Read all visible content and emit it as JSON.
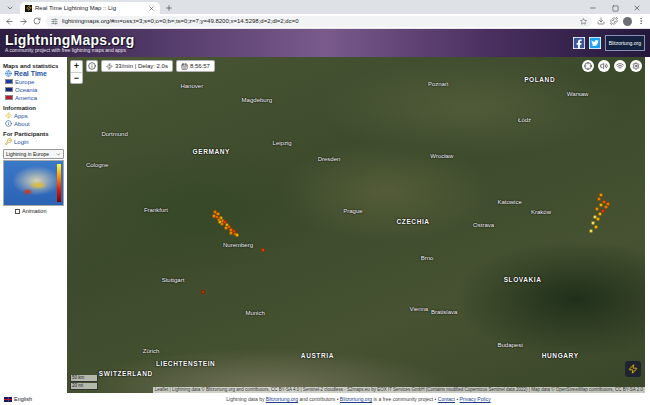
{
  "browser": {
    "tab": {
      "title": "Real Time Lightning Map :: Lig",
      "selected": true
    },
    "url": "lightningmaps.org/#m=oss;t=3;s=0;o=0;b=;ts=0;z=7;y=49.8200;x=14.5298;d=2;dl=2;dc=0"
  },
  "header": {
    "logo": "LightningMaps.org",
    "tagline": "A community project with free lightning maps and apps",
    "partner": "Blitzortung.org"
  },
  "sidebar": {
    "sections": [
      {
        "title": "Maps and statistics",
        "items": [
          {
            "label": "Real Time",
            "kind": "globe",
            "selected": true
          },
          {
            "label": "Europe",
            "kind": "flag",
            "color": "#1f3fa0",
            "selected": false
          },
          {
            "label": "Oceania",
            "kind": "flag",
            "color": "#14287a",
            "selected": false
          },
          {
            "label": "America",
            "kind": "flag",
            "color": "#b22234",
            "selected": false
          }
        ]
      },
      {
        "title": "Information",
        "items": [
          {
            "label": "Apps",
            "kind": "bolt",
            "selected": false
          },
          {
            "label": "About",
            "kind": "info",
            "selected": false
          }
        ]
      },
      {
        "title": "For Participants",
        "items": [
          {
            "label": "Login",
            "kind": "key",
            "selected": false
          }
        ]
      }
    ],
    "select": "Lightning in Europe",
    "animation": {
      "label": "Animation",
      "checked": false
    }
  },
  "map": {
    "center": {
      "lat": 49.82,
      "lon": 14.5298
    },
    "controls": {
      "zoom_in": "+",
      "zoom_out": "−",
      "rate": "33/min | Delay: 2.0s",
      "time": "8:56:57"
    },
    "scale": [
      "50 km",
      "20 mi"
    ],
    "attribution": "Leaflet | Lightning data © Blitzortung.org and contributors, CC BY-SA 4.0 | Sentinel-2 cloudless - S2maps.eu by EOX IT Services GmbH (Contains modified Copernicus Sentinel data 2022) | Map data © OpenStreetMap contributors, CC BY-SA 2.0",
    "places": [
      {
        "name": "Hanover",
        "kind": "city",
        "lat": 52.37,
        "lon": 9.73
      },
      {
        "name": "Magdeburg",
        "kind": "city",
        "lat": 52.13,
        "lon": 11.63
      },
      {
        "name": "Dortmund",
        "kind": "city",
        "lat": 51.51,
        "lon": 7.47
      },
      {
        "name": "Cologne",
        "kind": "city",
        "lat": 50.94,
        "lon": 6.96
      },
      {
        "name": "Leipzig",
        "kind": "city",
        "lat": 51.34,
        "lon": 12.37
      },
      {
        "name": "Dresden",
        "kind": "city",
        "lat": 51.05,
        "lon": 13.74
      },
      {
        "name": "Frankfurt",
        "kind": "city",
        "lat": 50.11,
        "lon": 8.68
      },
      {
        "name": "Nuremberg",
        "kind": "city",
        "lat": 49.45,
        "lon": 11.08
      },
      {
        "name": "Stuttgart",
        "kind": "city",
        "lat": 48.78,
        "lon": 9.18
      },
      {
        "name": "Munich",
        "kind": "city",
        "lat": 48.14,
        "lon": 11.58
      },
      {
        "name": "Zürich",
        "kind": "city",
        "lat": 47.38,
        "lon": 8.54
      },
      {
        "name": "Prague",
        "kind": "city",
        "lat": 50.08,
        "lon": 14.44
      },
      {
        "name": "Brno",
        "kind": "city",
        "lat": 49.2,
        "lon": 16.61
      },
      {
        "name": "Wrocław",
        "kind": "city",
        "lat": 51.11,
        "lon": 17.04
      },
      {
        "name": "Poznań",
        "kind": "city",
        "lat": 52.41,
        "lon": 16.93
      },
      {
        "name": "Łódź",
        "kind": "city",
        "lat": 51.76,
        "lon": 19.46
      },
      {
        "name": "Warsaw",
        "kind": "city",
        "lat": 52.23,
        "lon": 21.01
      },
      {
        "name": "Katowice",
        "kind": "city",
        "lat": 50.26,
        "lon": 19.02
      },
      {
        "name": "Kraków",
        "kind": "city",
        "lat": 50.06,
        "lon": 19.94
      },
      {
        "name": "Ostrava",
        "kind": "city",
        "lat": 49.82,
        "lon": 18.26
      },
      {
        "name": "Vienna",
        "kind": "city",
        "lat": 48.21,
        "lon": 16.37
      },
      {
        "name": "Bratislava",
        "kind": "city",
        "lat": 48.15,
        "lon": 17.11
      },
      {
        "name": "Budapest",
        "kind": "city",
        "lat": 47.5,
        "lon": 19.04
      },
      {
        "name": "GERMANY",
        "kind": "country",
        "lat": 51.2,
        "lon": 10.3
      },
      {
        "name": "CZECHIA",
        "kind": "country",
        "lat": 49.9,
        "lon": 16.2
      },
      {
        "name": "POLAND",
        "kind": "country",
        "lat": 52.5,
        "lon": 19.9
      },
      {
        "name": "SLOVAKIA",
        "kind": "country",
        "lat": 48.8,
        "lon": 19.4
      },
      {
        "name": "AUSTRIA",
        "kind": "country",
        "lat": 47.3,
        "lon": 13.4
      },
      {
        "name": "HUNGARY",
        "kind": "country",
        "lat": 47.3,
        "lon": 20.5
      },
      {
        "name": "LIECHTENSTEIN",
        "kind": "country",
        "lat": 47.14,
        "lon": 9.55
      },
      {
        "name": "SWITZERLAND",
        "kind": "country",
        "lat": 46.95,
        "lon": 7.8
      }
    ],
    "strikes": [
      {
        "lat": 50.06,
        "lon": 10.42,
        "color": "#ff8c00"
      },
      {
        "lat": 50.02,
        "lon": 10.5,
        "color": "#ffa500"
      },
      {
        "lat": 49.98,
        "lon": 10.46,
        "color": "#ff6a00"
      },
      {
        "lat": 49.95,
        "lon": 10.58,
        "color": "#ffd000"
      },
      {
        "lat": 49.92,
        "lon": 10.52,
        "color": "#ff8c00"
      },
      {
        "lat": 49.9,
        "lon": 10.64,
        "color": "#ffa500"
      },
      {
        "lat": 49.87,
        "lon": 10.7,
        "color": "#ff4500"
      },
      {
        "lat": 49.84,
        "lon": 10.62,
        "color": "#ff8c00"
      },
      {
        "lat": 49.82,
        "lon": 10.76,
        "color": "#ffd000"
      },
      {
        "lat": 49.79,
        "lon": 10.82,
        "color": "#ff6a00"
      },
      {
        "lat": 49.76,
        "lon": 10.74,
        "color": "#ffa500"
      },
      {
        "lat": 49.73,
        "lon": 10.88,
        "color": "#ff8c00"
      },
      {
        "lat": 49.7,
        "lon": 10.95,
        "color": "#ff4500"
      },
      {
        "lat": 49.67,
        "lon": 10.86,
        "color": "#ffa500"
      },
      {
        "lat": 49.65,
        "lon": 11.0,
        "color": "#ff6a00"
      },
      {
        "lat": 49.63,
        "lon": 11.06,
        "color": "#ffd000"
      },
      {
        "lat": 49.99,
        "lon": 10.38,
        "color": "#ffa500"
      },
      {
        "lat": 49.88,
        "lon": 10.56,
        "color": "#ffd000"
      },
      {
        "lat": 48.55,
        "lon": 10.05,
        "color": "#cc3300"
      },
      {
        "lat": 49.35,
        "lon": 11.8,
        "color": "#ff4500"
      },
      {
        "lat": 50.38,
        "lon": 21.7,
        "color": "#ffa500"
      },
      {
        "lat": 50.3,
        "lon": 21.62,
        "color": "#ff8c00"
      },
      {
        "lat": 50.26,
        "lon": 21.78,
        "color": "#ff6a00"
      },
      {
        "lat": 50.2,
        "lon": 21.68,
        "color": "#ffd000"
      },
      {
        "lat": 50.16,
        "lon": 21.84,
        "color": "#ff8c00"
      },
      {
        "lat": 50.12,
        "lon": 21.58,
        "color": "#ffa500"
      },
      {
        "lat": 50.08,
        "lon": 21.74,
        "color": "#ff4500"
      },
      {
        "lat": 50.03,
        "lon": 21.66,
        "color": "#ffd000"
      },
      {
        "lat": 49.98,
        "lon": 21.52,
        "color": "#ffff66"
      },
      {
        "lat": 49.93,
        "lon": 21.6,
        "color": "#ffd000"
      },
      {
        "lat": 49.86,
        "lon": 21.46,
        "color": "#ffff66"
      },
      {
        "lat": 49.78,
        "lon": 21.54,
        "color": "#ffd000"
      },
      {
        "lat": 49.7,
        "lon": 21.4,
        "color": "#ffff66"
      },
      {
        "lat": 50.22,
        "lon": 21.9,
        "color": "#ff8c00"
      }
    ]
  },
  "footer": {
    "language": "English",
    "parts": [
      {
        "text": "Lightning data by ",
        "link": false
      },
      {
        "text": "Blitzortung.org",
        "link": true
      },
      {
        "text": " and contributors • ",
        "link": false
      },
      {
        "text": "Blitzortung.org",
        "link": true
      },
      {
        "text": " is a free community project • ",
        "link": false
      },
      {
        "text": "Contact",
        "link": true
      },
      {
        "text": " • ",
        "link": false
      },
      {
        "text": "Privacy Policy",
        "link": true
      }
    ]
  }
}
